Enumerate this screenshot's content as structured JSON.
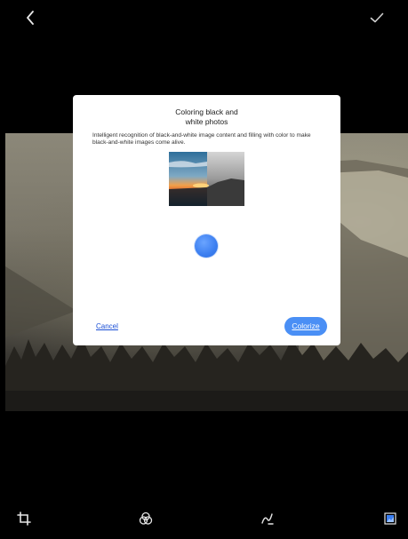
{
  "topbar": {
    "back_icon": "chevron-left-icon",
    "confirm_icon": "checkmark-icon"
  },
  "dialog": {
    "title_line1": "Coloring black and",
    "title_line2": "white photos",
    "description": "Intelligent recognition of black-and-white image content and filling with color to make black-and-white images come alive.",
    "cancel_label": "Cancel",
    "colorize_label": "Colorize",
    "accent_color": "#4a8ff5"
  },
  "toolbar": {
    "icons": [
      "crop-icon",
      "filter-circles-icon",
      "draw-icon",
      "image-icon"
    ]
  }
}
